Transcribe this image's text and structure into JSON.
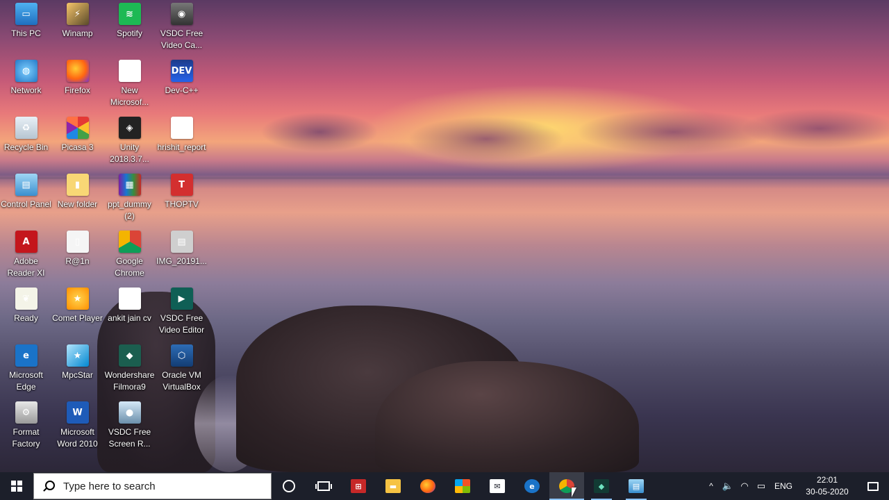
{
  "desktop": {
    "icons": [
      {
        "label": "This PC",
        "icon": "computer-icon",
        "glyph": "▭"
      },
      {
        "label": "Network",
        "icon": "network-icon",
        "glyph": "◍"
      },
      {
        "label": "Recycle Bin",
        "icon": "recycle-bin-icon",
        "glyph": "♻"
      },
      {
        "label": "Control Panel",
        "icon": "control-panel-icon",
        "glyph": "▤"
      },
      {
        "label": "Adobe\nReader XI",
        "icon": "adobe-reader-icon",
        "glyph": "A"
      },
      {
        "label": "Ready",
        "icon": "ready-icon",
        "glyph": "❦"
      },
      {
        "label": "Microsoft\nEdge",
        "icon": "edge-icon",
        "glyph": "e"
      },
      {
        "label": "Format\nFactory",
        "icon": "format-factory-icon",
        "glyph": "⚙"
      },
      {
        "label": "Winamp",
        "icon": "winamp-icon",
        "glyph": "⚡"
      },
      {
        "label": "Firefox",
        "icon": "firefox-icon",
        "glyph": ""
      },
      {
        "label": "Picasa 3",
        "icon": "picasa-icon",
        "glyph": ""
      },
      {
        "label": "New folder",
        "icon": "folder-icon",
        "glyph": "▮"
      },
      {
        "label": "R@1n",
        "icon": "blank-file-icon",
        "glyph": "▯"
      },
      {
        "label": "Comet Player",
        "icon": "comet-player-icon",
        "glyph": "★"
      },
      {
        "label": "MpcStar",
        "icon": "mpcstar-icon",
        "glyph": "★"
      },
      {
        "label": "Microsoft\nWord 2010",
        "icon": "word-icon",
        "glyph": "W"
      },
      {
        "label": "Spotify",
        "icon": "spotify-icon",
        "glyph": "≋"
      },
      {
        "label": "New\nMicrosof...",
        "icon": "word-document-icon",
        "glyph": "W"
      },
      {
        "label": "Unity\n2018.3.7...",
        "icon": "unity-icon",
        "glyph": "◈"
      },
      {
        "label": "ppt_dummy\n(2)",
        "icon": "winrar-archive-icon",
        "glyph": "▦"
      },
      {
        "label": "Google\nChrome",
        "icon": "chrome-icon",
        "glyph": ""
      },
      {
        "label": "ankit jain cv",
        "icon": "word-document-icon",
        "glyph": "W"
      },
      {
        "label": "Wondershare\nFilmora9",
        "icon": "filmora-icon",
        "glyph": "◆"
      },
      {
        "label": "VSDC Free\nScreen R...",
        "icon": "vsdc-screen-recorder-icon",
        "glyph": "●"
      },
      {
        "label": "VSDC Free\nVideo Ca...",
        "icon": "vsdc-video-capture-icon",
        "glyph": "◉"
      },
      {
        "label": "Dev-C++",
        "icon": "dev-cpp-icon",
        "glyph": "DEV"
      },
      {
        "label": "hrishit_report",
        "icon": "word-document-icon",
        "glyph": "W"
      },
      {
        "label": "THOPTV",
        "icon": "thoptv-icon",
        "glyph": "T"
      },
      {
        "label": "IMG_20191...",
        "icon": "image-file-icon",
        "glyph": "▤"
      },
      {
        "label": "VSDC Free\nVideo Editor",
        "icon": "vsdc-video-editor-icon",
        "glyph": "▶"
      },
      {
        "label": "Oracle VM\nVirtualBox",
        "icon": "virtualbox-icon",
        "glyph": "⬡"
      }
    ]
  },
  "taskbar": {
    "search_placeholder": "Type here to search",
    "pinned": [
      {
        "name": "cortana-button",
        "icon": "cortana-icon"
      },
      {
        "name": "task-view-button",
        "icon": "task-view-icon"
      },
      {
        "name": "gift-app-button",
        "icon": "gift-icon",
        "glyph": "⊞"
      },
      {
        "name": "file-explorer-button",
        "icon": "folder-icon",
        "glyph": "▬"
      },
      {
        "name": "firefox-taskbar-button",
        "icon": "firefox-icon",
        "glyph": ""
      },
      {
        "name": "store-button",
        "icon": "store-icon",
        "glyph": ""
      },
      {
        "name": "mail-button",
        "icon": "mail-icon",
        "glyph": "✉"
      },
      {
        "name": "edge-taskbar-button",
        "icon": "edge-icon",
        "glyph": "e"
      },
      {
        "name": "chrome-taskbar-button",
        "icon": "chrome-icon",
        "glyph": ""
      },
      {
        "name": "filmora-taskbar-button",
        "icon": "filmora-icon",
        "glyph": "◆"
      },
      {
        "name": "control-panel-taskbar-button",
        "icon": "control-panel-icon",
        "glyph": "▤"
      }
    ],
    "tray": {
      "chevron": "^",
      "volume": "🔈",
      "wifi": "◠",
      "battery": "▭",
      "language": "ENG",
      "time": "22:01",
      "date": "30-05-2020"
    }
  }
}
